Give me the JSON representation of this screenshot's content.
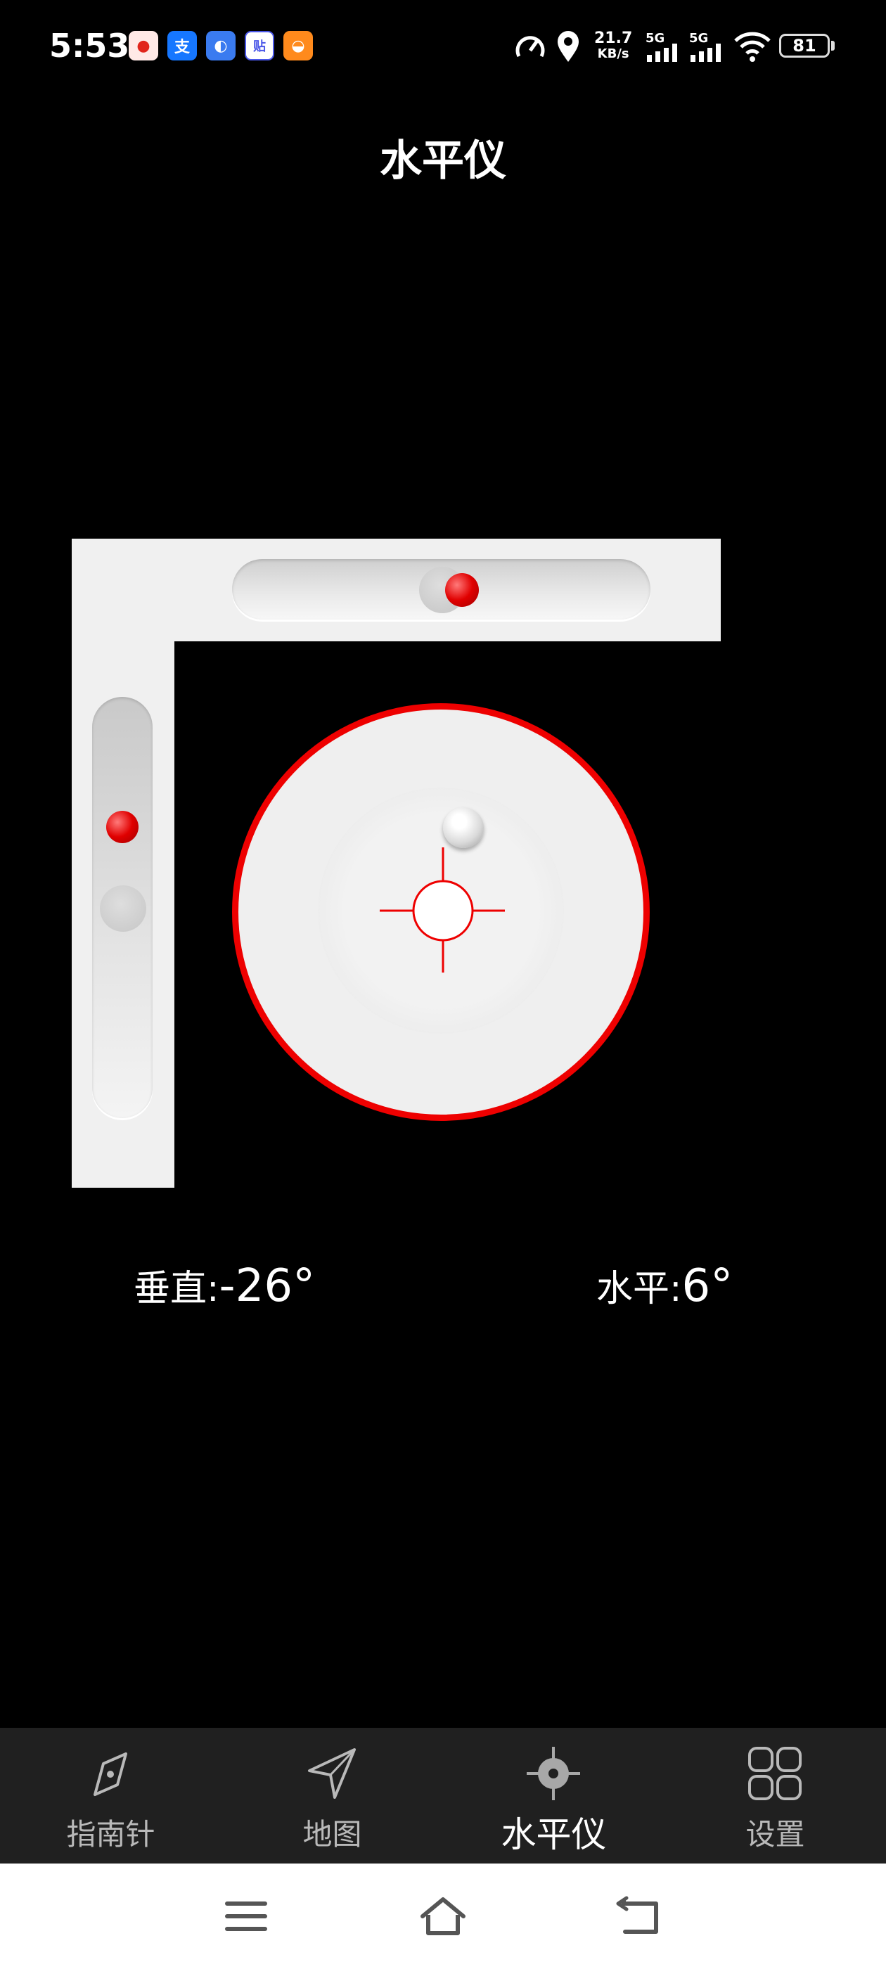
{
  "status_bar": {
    "time": "5:53",
    "net_speed_value": "21.7",
    "net_speed_unit": "KB/s",
    "sim1": "5G",
    "sim2": "5G",
    "battery": "81",
    "app_icons": [
      "meituan-icon",
      "alipay-icon",
      "app-icon",
      "tieba-icon",
      "app-icon-orange"
    ]
  },
  "page_title": "水平仪",
  "readouts": {
    "vertical_label": "垂直:",
    "vertical_value": "-26°",
    "horizontal_label": "水平:",
    "horizontal_value": "6°"
  },
  "bottom_nav": {
    "items": [
      {
        "label": "指南针",
        "icon": "compass-icon"
      },
      {
        "label": "地图",
        "icon": "navigation-arrow-icon"
      },
      {
        "label": "水平仪",
        "icon": "level-crosshair-icon",
        "active": true
      },
      {
        "label": "设置",
        "icon": "grid-settings-icon"
      }
    ]
  },
  "colors": {
    "accent_red": "#ee0000",
    "background": "#000000",
    "nav_background": "#202020",
    "level_body": "#f0f0f0"
  }
}
